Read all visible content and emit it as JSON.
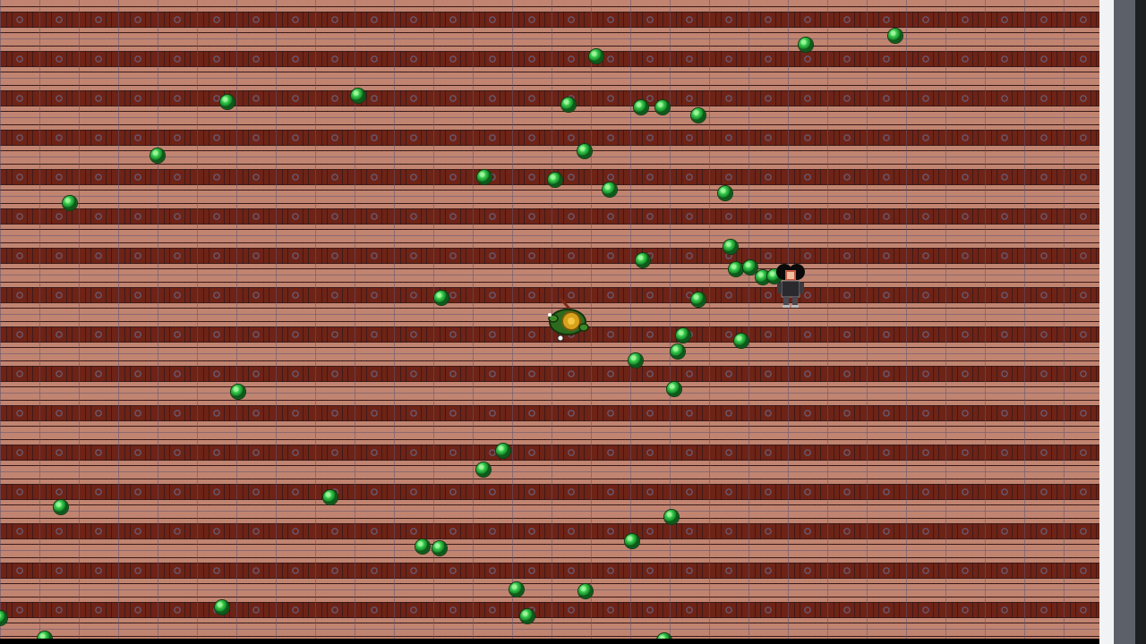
{
  "scene": {
    "floor_color": "#c08470",
    "pattern_color": "#685a74",
    "gem_color": "#35c84a",
    "gem_count": 45
  },
  "player": {
    "icon": "turtle-hero-icon"
  },
  "npc": {
    "icon": "dark-haired-character-icon"
  },
  "frame": {
    "right_panel_color": "#5c6068"
  }
}
